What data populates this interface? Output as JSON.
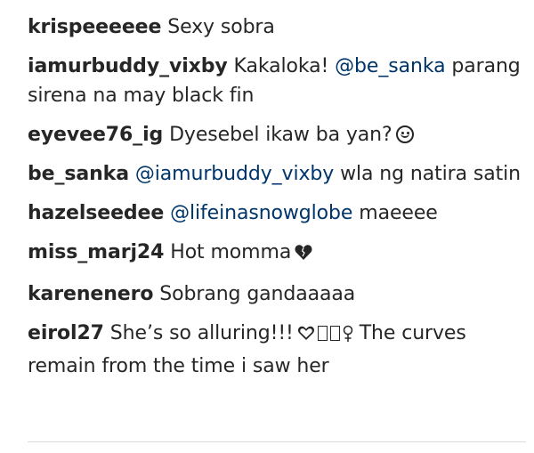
{
  "comments": [
    {
      "user": "krispeeeeee",
      "text": "Sexy sobra"
    },
    {
      "user": "iamurbuddy_vixby",
      "text": "Kakaloka!",
      "mention": "@be_sanka",
      "text2": "parang sirena na may black fin"
    },
    {
      "user": "eyevee76_ig",
      "text": "Dyesebel ikaw ba yan?",
      "emoji": "smiley-icon"
    },
    {
      "user": "be_sanka",
      "mention": "@iamurbuddy_vixby",
      "text": "wla ng natira satin"
    },
    {
      "user": "hazelseedee",
      "mention": "@lifeinasnowglobe",
      "text": "maeeee"
    },
    {
      "user": "miss_marj24",
      "text": "Hot momma",
      "emoji": "black-heart-icon"
    },
    {
      "user": "karenenero",
      "text": "Sobrang gandaaaaa"
    },
    {
      "user": "eirol27",
      "text": "She’s so alluring!!!",
      "emoji": "heart-female-icons",
      "text2": "The curves remain from the time i saw her"
    }
  ]
}
